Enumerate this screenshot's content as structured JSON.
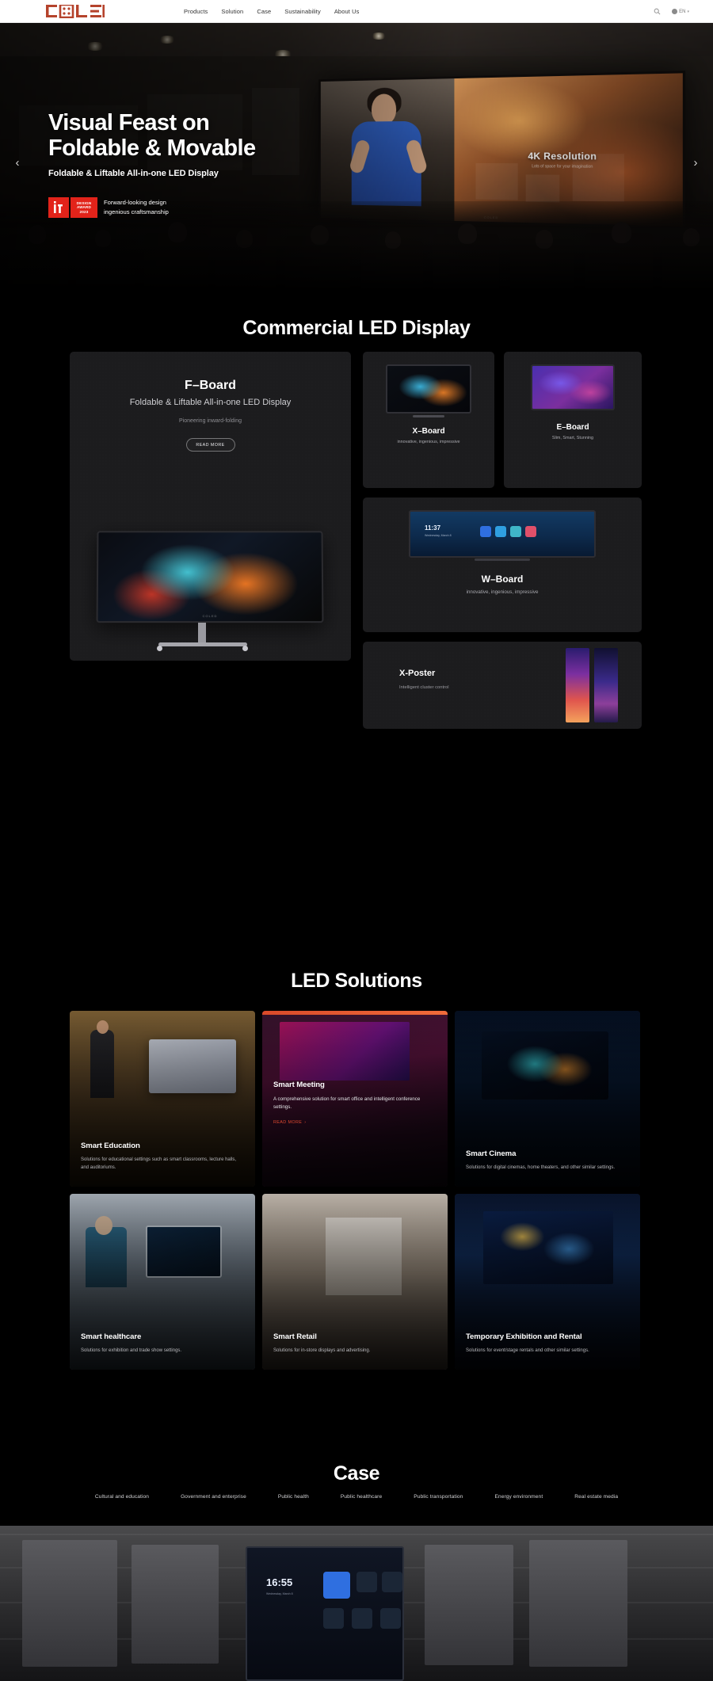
{
  "brand": {
    "name": "COLED",
    "logo_colors": {
      "primary": "#b5432c"
    }
  },
  "header": {
    "nav": [
      {
        "label": "Products"
      },
      {
        "label": "Solution"
      },
      {
        "label": "Case"
      },
      {
        "label": "Sustainability"
      },
      {
        "label": "About Us"
      }
    ],
    "search_icon": "search-icon",
    "language": {
      "label": "EN",
      "icon": "globe-icon",
      "caret": "▾"
    }
  },
  "hero": {
    "title_line1": "Visual Feast on",
    "title_line2": "Foldable & Movable",
    "subtitle": "Foldable & Liftable All-in-one LED Display",
    "award": {
      "mark": "iF",
      "line1": "DESIGN",
      "line2": "AWARD",
      "line3": "2023",
      "text_line1": "Forward-looking design",
      "text_line2": "ingenious craftsmanship"
    },
    "screen_caption": {
      "title": "4K Resolution",
      "subtitle": "Lots of space for your imagination"
    },
    "screen_brand": "COLED",
    "prev_arrow": "‹",
    "next_arrow": "›"
  },
  "products": {
    "section_title": "Commercial LED Display",
    "f_board": {
      "title": "F–Board",
      "subtitle": "Foldable & Liftable All-in-one LED Display",
      "note": "Pioneering inward-folding",
      "cta": "READ MORE",
      "device_brand": "COLED"
    },
    "x_board": {
      "title": "X–Board",
      "subtitle": "innovative, ingenious, impressive"
    },
    "e_board": {
      "title": "E–Board",
      "subtitle": "Slim, Smart, Stunning"
    },
    "w_board": {
      "title": "W–Board",
      "subtitle": "innovative, ingenious, impressive",
      "screen_time": "11:37",
      "screen_date": "Wednesday, March 8"
    },
    "x_poster": {
      "title": "X-Poster",
      "subtitle": "Intelligent cluster control"
    }
  },
  "solutions": {
    "section_title": "LED Solutions",
    "cards": [
      {
        "title": "Smart Education",
        "desc": "Solutions for educational settings such as smart classrooms, lecture halls, and auditoriums."
      },
      {
        "title": "Smart Meeting",
        "desc": "A comprehensive solution for smart office and intelligent conference settings.",
        "cta": "READ MORE",
        "cta_arrow": "›",
        "featured": true
      },
      {
        "title": "Smart Cinema",
        "desc": "Solutions for digital cinemas, home theaters, and other similar settings."
      },
      {
        "title": "Smart healthcare",
        "desc": "Solutions for exhibition and trade show settings."
      },
      {
        "title": "Smart Retail",
        "desc": "Solutions for in-store displays and advertising."
      },
      {
        "title": "Temporary Exhibition and Rental",
        "desc": "Solutions for event/stage rentals and other similar settings."
      }
    ]
  },
  "case": {
    "section_title": "Case",
    "tabs": [
      {
        "label": "Cultural and education"
      },
      {
        "label": "Government and enterprise"
      },
      {
        "label": "Public health"
      },
      {
        "label": "Public healthcare"
      },
      {
        "label": "Public transportation"
      },
      {
        "label": "Energy environment"
      },
      {
        "label": "Real estate media"
      }
    ],
    "stage_time": "16:55",
    "stage_sub": "Wednesday, March 8"
  }
}
